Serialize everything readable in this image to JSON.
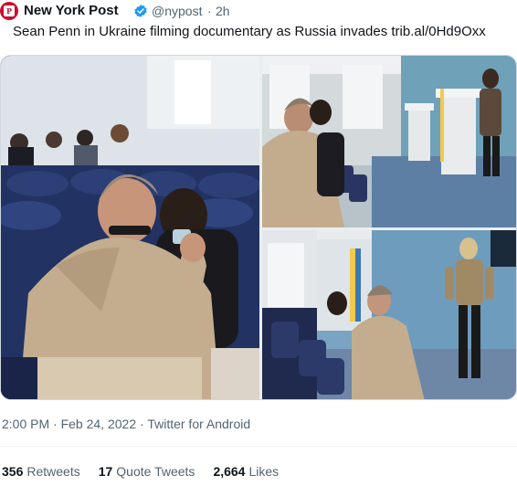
{
  "account": {
    "display_name": "New York Post",
    "handle": "@nypost",
    "separator": "·",
    "time_ago": "2h",
    "avatar_letter": "P",
    "verified": true,
    "brand_color": "#c8102e",
    "verified_color": "#1d9bf0"
  },
  "tweet": {
    "text": "Sean Penn in Ukraine filming documentary as Russia invades",
    "link": "trib.al/0Hd9Oxx"
  },
  "media": {
    "photo_count": 3,
    "icons": [
      "photo-press-conference",
      "photo-briefing-room",
      "photo-podium-speaker"
    ]
  },
  "meta": {
    "time": "2:00 PM",
    "separator_1": "·",
    "date": "Feb 24, 2022",
    "separator_2": "·",
    "source": "Twitter for Android"
  },
  "stats": {
    "retweets_count": "356",
    "retweets_label": "Retweets",
    "quotes_count": "17",
    "quotes_label": "Quote Tweets",
    "likes_count": "2,664",
    "likes_label": "Likes"
  }
}
